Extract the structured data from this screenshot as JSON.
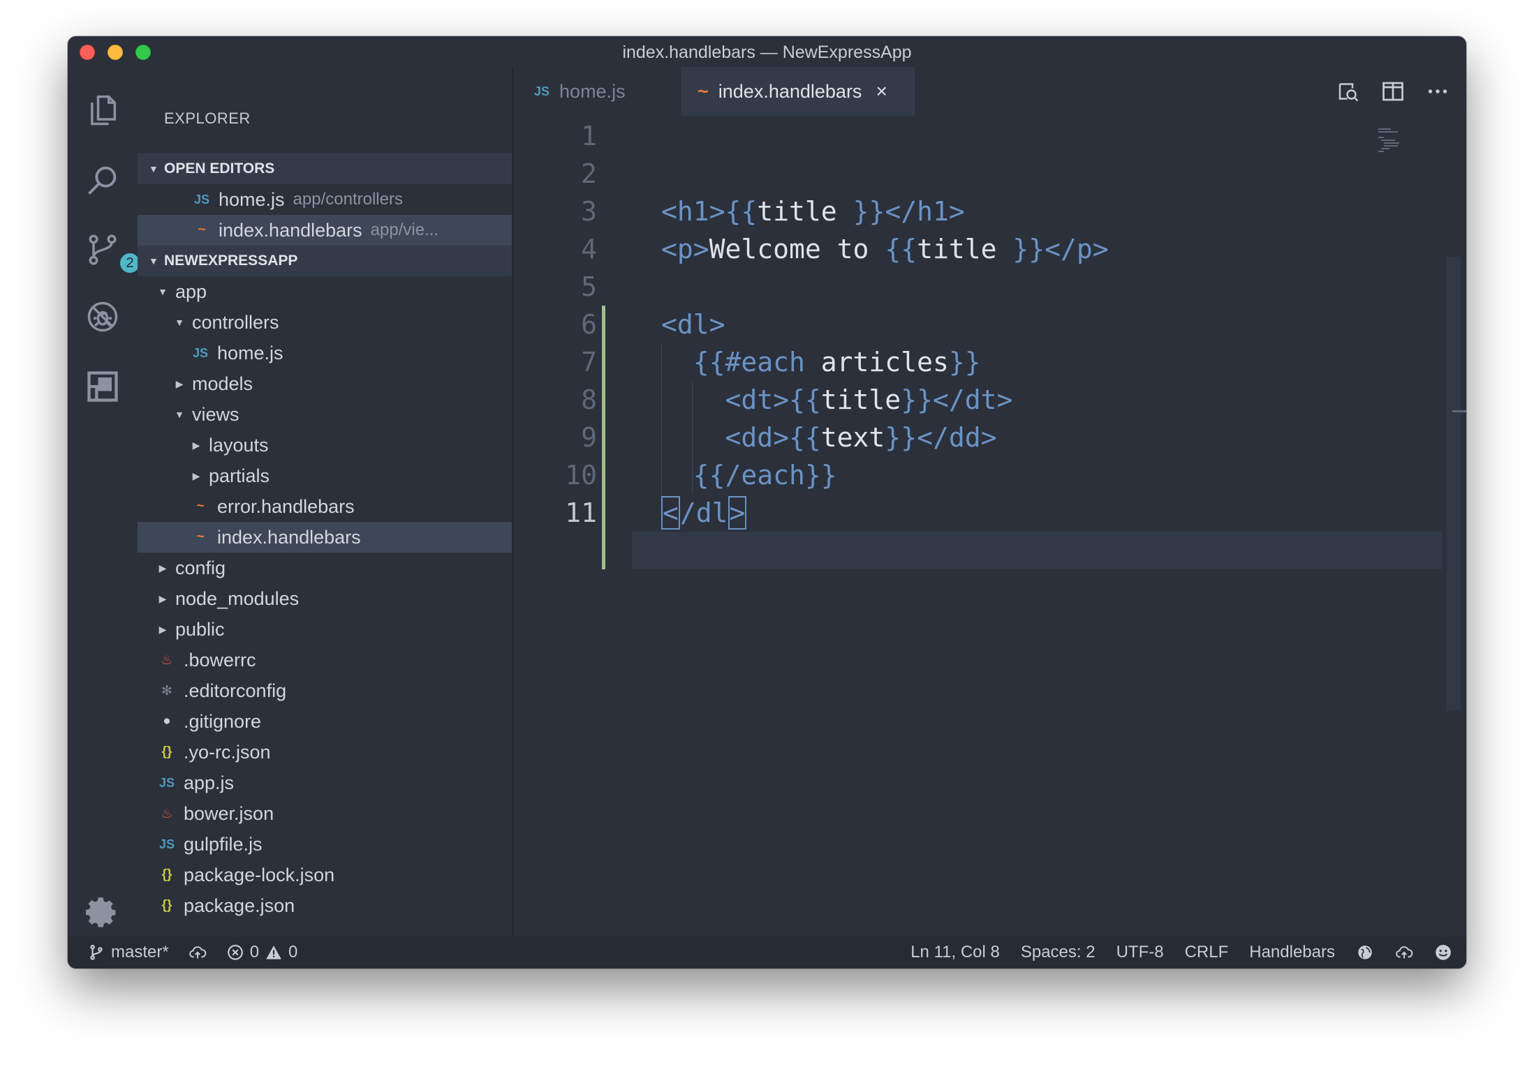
{
  "window": {
    "title": "index.handlebars — NewExpressApp"
  },
  "activity_bar": {
    "items": [
      {
        "icon": "files-icon"
      },
      {
        "icon": "search-icon"
      },
      {
        "icon": "source-control-icon",
        "badge": "2"
      },
      {
        "icon": "debug-icon"
      },
      {
        "icon": "extensions-icon"
      }
    ],
    "settings_icon": "gear-icon"
  },
  "sidebar": {
    "title": "EXPLORER",
    "open_editors": {
      "header": "OPEN EDITORS",
      "items": [
        {
          "icon": "JS",
          "name": "home.js",
          "hint": "app/controllers"
        },
        {
          "icon": "~",
          "name": "index.handlebars",
          "hint": "app/vie..."
        }
      ]
    },
    "project": {
      "header": "NEWEXPRESSAPP",
      "items": [
        {
          "name": "app",
          "twist": "▼",
          "depth": 1
        },
        {
          "name": "controllers",
          "twist": "▼",
          "depth": 2
        },
        {
          "name": "home.js",
          "icon": "JS",
          "depth": 3
        },
        {
          "name": "models",
          "twist": "▶",
          "depth": 2
        },
        {
          "name": "views",
          "twist": "▼",
          "depth": 2
        },
        {
          "name": "layouts",
          "twist": "▶",
          "depth": 3
        },
        {
          "name": "partials",
          "twist": "▶",
          "depth": 3
        },
        {
          "name": "error.handlebars",
          "icon": "~",
          "depth": 3
        },
        {
          "name": "index.handlebars",
          "icon": "~",
          "depth": 3,
          "selected": true
        },
        {
          "name": "config",
          "twist": "▶",
          "depth": 1
        },
        {
          "name": "node_modules",
          "twist": "▶",
          "depth": 1
        },
        {
          "name": "public",
          "twist": "▶",
          "depth": 1
        },
        {
          "name": ".bowerrc",
          "icon": "bower",
          "depth": 1
        },
        {
          "name": ".editorconfig",
          "icon": "gear",
          "depth": 1
        },
        {
          "name": ".gitignore",
          "icon": "git",
          "depth": 1
        },
        {
          "name": ".yo-rc.json",
          "icon": "{}",
          "depth": 1
        },
        {
          "name": "app.js",
          "icon": "JS",
          "depth": 1
        },
        {
          "name": "bower.json",
          "icon": "bower",
          "depth": 1
        },
        {
          "name": "gulpfile.js",
          "icon": "JS",
          "depth": 1
        },
        {
          "name": "package-lock.json",
          "icon": "{}",
          "depth": 1
        },
        {
          "name": "package.json",
          "icon": "{}",
          "depth": 1
        }
      ]
    }
  },
  "tabs": [
    {
      "icon": "JS",
      "label": "home.js",
      "active": false
    },
    {
      "icon": "~",
      "label": "index.handlebars",
      "active": true,
      "close": "×"
    }
  ],
  "editor": {
    "line_numbers": [
      "1",
      "2",
      "3",
      "4",
      "5",
      "6",
      "7",
      "8",
      "9",
      "10",
      "11"
    ],
    "lines": [
      [],
      [],
      [
        {
          "t": "<h1>",
          "c": "tag"
        },
        {
          "t": "{{",
          "c": "brace"
        },
        {
          "t": "title ",
          "c": "plain"
        },
        {
          "t": "}}",
          "c": "brace"
        },
        {
          "t": "</h1>",
          "c": "tag"
        }
      ],
      [
        {
          "t": "<p>",
          "c": "tag"
        },
        {
          "t": "Welcome to ",
          "c": "plain"
        },
        {
          "t": "{{",
          "c": "brace"
        },
        {
          "t": "title ",
          "c": "plain"
        },
        {
          "t": "}}",
          "c": "brace"
        },
        {
          "t": "</p>",
          "c": "tag"
        }
      ],
      [],
      [
        {
          "t": "<dl>",
          "c": "tag"
        }
      ],
      [
        {
          "t": "  ",
          "c": "plain"
        },
        {
          "t": "{{#each",
          "c": "kw"
        },
        {
          "t": " articles",
          "c": "plain"
        },
        {
          "t": "}}",
          "c": "brace"
        }
      ],
      [
        {
          "t": "    ",
          "c": "plain"
        },
        {
          "t": "<dt>",
          "c": "tag"
        },
        {
          "t": "{{",
          "c": "brace"
        },
        {
          "t": "title",
          "c": "plain"
        },
        {
          "t": "}}",
          "c": "brace"
        },
        {
          "t": "</dt>",
          "c": "tag"
        }
      ],
      [
        {
          "t": "    ",
          "c": "plain"
        },
        {
          "t": "<dd>",
          "c": "tag"
        },
        {
          "t": "{{",
          "c": "brace"
        },
        {
          "t": "text",
          "c": "plain"
        },
        {
          "t": "}}",
          "c": "brace"
        },
        {
          "t": "</dd>",
          "c": "tag"
        }
      ],
      [
        {
          "t": "  ",
          "c": "plain"
        },
        {
          "t": "{{/each}}",
          "c": "brace"
        }
      ],
      [
        {
          "t": "<",
          "c": "tag box"
        },
        {
          "t": "/dl",
          "c": "tag"
        },
        {
          "t": ">",
          "c": "tag box"
        }
      ]
    ],
    "current_line": 11
  },
  "statusbar": {
    "branch": "master*",
    "errors": "0",
    "warnings": "0",
    "cursor": "Ln 11, Col 8",
    "indent": "Spaces: 2",
    "encoding": "UTF-8",
    "eol": "CRLF",
    "language": "Handlebars"
  },
  "colors": {
    "background": "#2b303b",
    "accent_tag": "#6b93c4",
    "modified_gutter": "#a3be8c",
    "handlebars_icon": "#f0763b",
    "js_icon": "#519aba",
    "json_icon": "#cbcb41"
  }
}
